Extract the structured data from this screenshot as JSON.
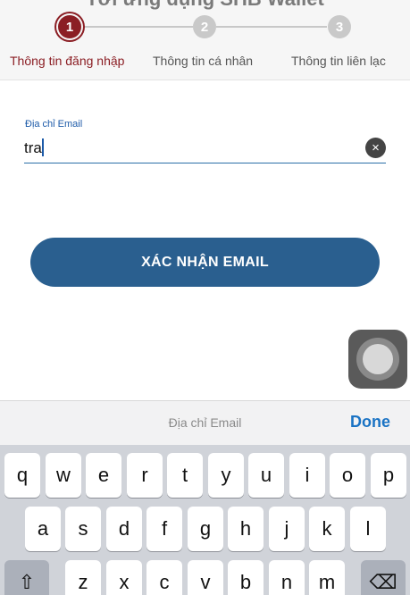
{
  "header": {
    "title": "Tới ứng dụng SHB Wallet"
  },
  "steps": [
    {
      "number": "1",
      "label": "Thông tin đăng nhập"
    },
    {
      "number": "2",
      "label": "Thông tin cá nhân"
    },
    {
      "number": "3",
      "label": "Thông tin liên lạc"
    }
  ],
  "form": {
    "email_label": "Địa chỉ Email",
    "email_value": "tra",
    "clear_icon": "×",
    "confirm_label": "XÁC NHẬN EMAIL"
  },
  "accessory": {
    "placeholder": "Địa chỉ Email",
    "done_label": "Done"
  },
  "keyboard": {
    "row1": [
      "q",
      "w",
      "e",
      "r",
      "t",
      "y",
      "u",
      "i",
      "o",
      "p"
    ],
    "row2": [
      "a",
      "s",
      "d",
      "f",
      "g",
      "h",
      "j",
      "k",
      "l"
    ],
    "row3": [
      "z",
      "x",
      "c",
      "v",
      "b",
      "n",
      "m"
    ],
    "shift_icon": "⇧",
    "backspace_icon": "⌫"
  },
  "colors": {
    "accent_red": "#8b1e24",
    "button_blue": "#2a5f8f",
    "link_blue": "#1a73c4"
  },
  "icons": {
    "clear": "clear-circle-icon",
    "assistive": "assistive-touch-icon",
    "shift": "shift-icon",
    "backspace": "backspace-icon"
  }
}
